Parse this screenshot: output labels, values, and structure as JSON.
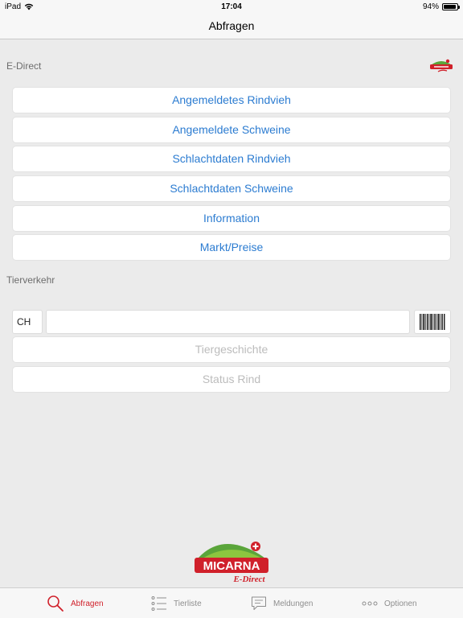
{
  "status_bar": {
    "device": "iPad",
    "time": "17:04",
    "battery": "94%",
    "battery_level": 0.94
  },
  "nav": {
    "title": "Abfragen"
  },
  "edirect": {
    "section_label": "E-Direct",
    "buttons": [
      {
        "label": "Angemeldetes Rindvieh"
      },
      {
        "label": "Angemeldete Schweine"
      },
      {
        "label": "Schlachtdaten Rindvieh"
      },
      {
        "label": "Schlachtdaten Schweine"
      },
      {
        "label": "Information"
      },
      {
        "label": "Markt/Preise"
      }
    ]
  },
  "tierverkehr": {
    "section_label": "Tierverkehr",
    "country_code": "CH",
    "animal_number_value": "",
    "buttons": [
      {
        "label": "Tiergeschichte"
      },
      {
        "label": "Status Rind"
      }
    ]
  },
  "brand": {
    "logo_text": "MICARNA",
    "logo_sub": "E-Direct"
  },
  "tabs": [
    {
      "label": "Abfragen",
      "icon": "search-icon",
      "active": true
    },
    {
      "label": "Tierliste",
      "icon": "list-icon",
      "active": false
    },
    {
      "label": "Meldungen",
      "icon": "message-icon",
      "active": false
    },
    {
      "label": "Optionen",
      "icon": "more-icon",
      "active": false
    }
  ],
  "colors": {
    "accent_blue": "#2c7cd1",
    "active_tab_red": "#d0202a",
    "brand_green": "#5aa53a"
  }
}
